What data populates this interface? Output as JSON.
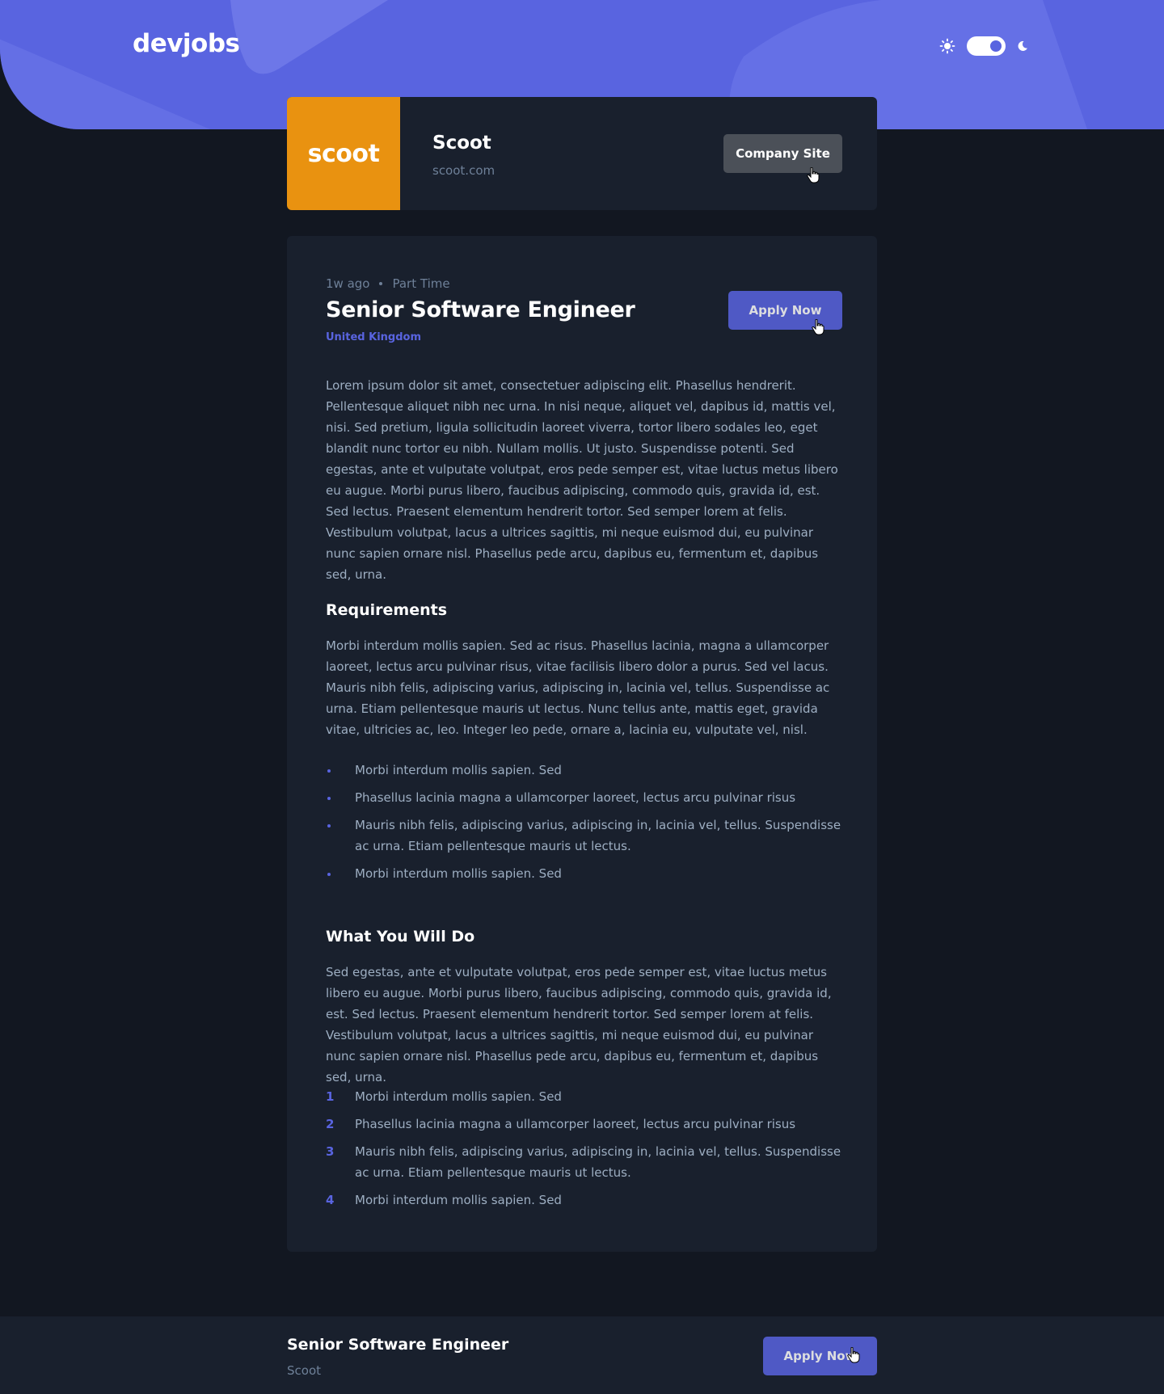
{
  "header": {
    "logo": "devjobs",
    "theme": {
      "sun_icon": "sun-icon",
      "moon_icon": "moon-icon",
      "mode": "dark"
    }
  },
  "company": {
    "logo_text": "scoot",
    "logo_color": "#e99210",
    "name": "Scoot",
    "website": "scoot.com",
    "site_button": "Company Site"
  },
  "job": {
    "posted": "1w ago",
    "contract": "Part Time",
    "title": "Senior Software Engineer",
    "location": "United Kingdom",
    "apply_label": "Apply Now",
    "description": "Lorem ipsum dolor sit amet, consectetuer adipiscing elit. Phasellus hendrerit. Pellentesque aliquet nibh nec urna. In nisi neque, aliquet vel, dapibus id, mattis vel, nisi. Sed pretium, ligula sollicitudin laoreet viverra, tortor libero sodales leo, eget blandit nunc tortor eu nibh. Nullam mollis. Ut justo. Suspendisse potenti. Sed egestas, ante et vulputate volutpat, eros pede semper est, vitae luctus metus libero eu augue. Morbi purus libero, faucibus adipiscing, commodo quis, gravida id, est. Sed lectus. Praesent elementum hendrerit tortor. Sed semper lorem at felis. Vestibulum volutpat, lacus a ultrices sagittis, mi neque euismod dui, eu pulvinar nunc sapien ornare nisl. Phasellus pede arcu, dapibus eu, fermentum et, dapibus sed, urna.",
    "requirements": {
      "heading": "Requirements",
      "content": "Morbi interdum mollis sapien. Sed ac risus. Phasellus lacinia, magna a ullamcorper laoreet, lectus arcu pulvinar risus, vitae facilisis libero dolor a purus. Sed vel lacus. Mauris nibh felis, adipiscing varius, adipiscing in, lacinia vel, tellus. Suspendisse ac urna. Etiam pellentesque mauris ut lectus. Nunc tellus ante, mattis eget, gravida vitae, ultricies ac, leo. Integer leo pede, ornare a, lacinia eu, vulputate vel, nisl.",
      "items": [
        "Morbi interdum mollis sapien. Sed",
        "Phasellus lacinia magna a ullamcorper laoreet, lectus arcu pulvinar risus",
        "Mauris nibh felis, adipiscing varius, adipiscing in, lacinia vel, tellus. Suspendisse ac urna. Etiam pellentesque mauris ut lectus.",
        "Morbi interdum mollis sapien. Sed"
      ]
    },
    "role": {
      "heading": "What You Will Do",
      "content": "Sed egestas, ante et vulputate volutpat, eros pede semper est, vitae luctus metus libero eu augue. Morbi purus libero, faucibus adipiscing, commodo quis, gravida id, est. Sed lectus. Praesent elementum hendrerit tortor. Sed semper lorem at felis. Vestibulum volutpat, lacus a ultrices sagittis, mi neque euismod dui, eu pulvinar nunc sapien ornare nisl. Phasellus pede arcu, dapibus eu, fermentum et, dapibus sed, urna.",
      "items": [
        {
          "number": "1",
          "text": "Morbi interdum mollis sapien. Sed"
        },
        {
          "number": "2",
          "text": "Phasellus lacinia magna a ullamcorper laoreet, lectus arcu pulvinar risus"
        },
        {
          "number": "3",
          "text": "Mauris nibh felis, adipiscing varius, adipiscing in, lacinia vel, tellus. Suspendisse ac urna. Etiam pellentesque mauris ut lectus."
        },
        {
          "number": "4",
          "text": "Morbi interdum mollis sapien. Sed"
        }
      ]
    }
  },
  "footer": {
    "title": "Senior Software Engineer",
    "company": "Scoot",
    "apply_label": "Apply Now"
  },
  "colors": {
    "accent": "#5964e0",
    "background": "#121721",
    "card": "#19202d",
    "company_brand": "#e99210"
  }
}
